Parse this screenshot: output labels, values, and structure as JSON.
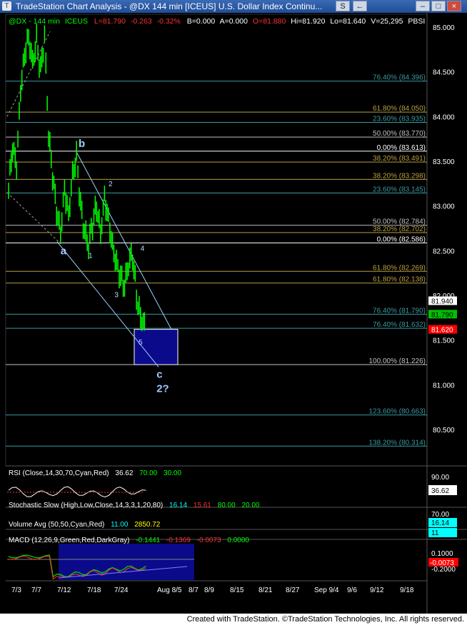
{
  "window": {
    "title": "TradeStation Chart Analysis - @DX 144 min [ICEUS] U.S. Dollar Index Continu...",
    "buttons": [
      "S",
      "←",
      "–",
      "□",
      "×"
    ]
  },
  "header": {
    "symbol": "@DX - 144 min",
    "exchange": "ICEUS",
    "last": "L=81.790",
    "change": "-0.263",
    "change_pct": "-0.32%",
    "bid": "B=0.000",
    "ask": "A=0.000",
    "open": "O=81.880",
    "high": "Hi=81.920",
    "low": "Lo=81.640",
    "volume": "V=25,295",
    "pbsi": "PBSI"
  },
  "price_axis": {
    "ticks": [
      "85.000",
      "84.500",
      "84.000",
      "83.500",
      "83.000",
      "82.500",
      "82.000",
      "81.500",
      "81.000",
      "80.500"
    ],
    "tick_values": [
      85.0,
      84.5,
      84.0,
      83.5,
      83.0,
      82.5,
      82.0,
      81.5,
      81.0,
      80.5
    ],
    "tags": [
      {
        "text": "81.940",
        "value": 81.94,
        "bg": "#ffffff",
        "fg": "#000000"
      },
      {
        "text": "81.790",
        "value": 81.79,
        "bg": "#00c000",
        "fg": "#000000"
      },
      {
        "text": "81.620",
        "value": 81.62,
        "bg": "#ff0000",
        "fg": "#ffffff"
      }
    ]
  },
  "date_axis": [
    "7/3",
    "7/7",
    "7/12",
    "7/18",
    "7/24",
    "Aug 8/5",
    "8/7",
    "8/9",
    "8/15",
    "8/21",
    "8/27",
    "Sep 9/4",
    "9/6",
    "9/12",
    "9/18"
  ],
  "fib_levels": [
    {
      "label": "76.40% (84.396)",
      "value": 84.396,
      "color": "#3a9aa0"
    },
    {
      "label": "61.80% (84.050)",
      "value": 84.05,
      "color": "#b8a040"
    },
    {
      "label": "23.60% (83.935)",
      "value": 83.935,
      "color": "#3a9aa0"
    },
    {
      "label": "50.00% (83.770)",
      "value": 83.77,
      "color": "#c0c0c0"
    },
    {
      "label": "0.00% (83.613)",
      "value": 83.613,
      "color": "#ffffff"
    },
    {
      "label": "38.20% (83.491)",
      "value": 83.491,
      "color": "#b8a040"
    },
    {
      "label": "38.20% (83.298)",
      "value": 83.298,
      "color": "#b8a040"
    },
    {
      "label": "23.60% (83.145)",
      "value": 83.145,
      "color": "#3a9aa0"
    },
    {
      "label": "50.00% (82.784)",
      "value": 82.784,
      "color": "#c0c0c0"
    },
    {
      "label": "38.20% (82.702)",
      "value": 82.702,
      "color": "#b8a040"
    },
    {
      "label": "0.00% (82.586)",
      "value": 82.586,
      "color": "#ffffff"
    },
    {
      "label": "61.80% (82.269)",
      "value": 82.269,
      "color": "#b8a040"
    },
    {
      "label": "61.80% (82.138)",
      "value": 82.138,
      "color": "#b8a040"
    },
    {
      "label": "76.40% (81.790)",
      "value": 81.79,
      "color": "#3a9aa0"
    },
    {
      "label": "76.40% (81.632)",
      "value": 81.632,
      "color": "#3a9aa0"
    },
    {
      "label": "100.00% (81.226)",
      "value": 81.226,
      "color": "#c0c0c0"
    },
    {
      "label": "123.60% (80.663)",
      "value": 80.663,
      "color": "#3a9aa0"
    },
    {
      "label": "138.20% (80.314)",
      "value": 80.314,
      "color": "#3a9aa0"
    }
  ],
  "wave_labels": [
    {
      "text": "b",
      "date_idx": 17.5,
      "value": 83.66,
      "size": "big"
    },
    {
      "text": "2",
      "date_idx": 25,
      "value": 83.22,
      "size": "small"
    },
    {
      "text": "a",
      "date_idx": 13,
      "value": 82.46,
      "size": "big"
    },
    {
      "text": "1",
      "date_idx": 20,
      "value": 82.42,
      "size": "small"
    },
    {
      "text": "4",
      "date_idx": 33,
      "value": 82.5,
      "size": "small"
    },
    {
      "text": "3",
      "date_idx": 26.5,
      "value": 81.98,
      "size": "small"
    },
    {
      "text": "5",
      "date_idx": 32.5,
      "value": 81.45,
      "size": "small"
    },
    {
      "text": "c",
      "date_idx": 37,
      "value": 81.08,
      "size": "big"
    },
    {
      "text": "2?",
      "date_idx": 37,
      "value": 80.92,
      "size": "big"
    }
  ],
  "indicators": {
    "rsi": {
      "label": "RSI (Close,14,30,70,Cyan,Red)",
      "value": "36.62",
      "ob": "70.00",
      "os": "30.00",
      "axis": [
        "90.00"
      ],
      "tag": "36.62"
    },
    "stochastic": {
      "label": "Stochastic Slow (High,Low,Close,14,3,3,1,20,80)",
      "k": "16.14",
      "d": "15.61",
      "ob": "80.00",
      "os": "20.00",
      "axis": [
        "70.00"
      ],
      "tag": "16.14"
    },
    "volume": {
      "label": "Volume Avg (50,50,Cyan,Red)",
      "value": "11.00",
      "avg": "2850.72",
      "tag": "11"
    },
    "macd": {
      "label": "MACD (12,26,9,Green,Red,DarkGray)",
      "macd": "-0.1441",
      "signal": "-0.1369",
      "hist": "-0.0073",
      "zero": "0.0000",
      "axis": [
        "0.1000",
        "-0.2000"
      ],
      "tag": "-0.0073"
    }
  },
  "footer": "Created with TradeStation. ©TradeStation Technologies, Inc. All rights reserved.",
  "chart_data": {
    "type": "candlestick",
    "title": "",
    "symbol": "@DX",
    "interval": "144 min",
    "ylim": [
      80.2,
      85.05
    ],
    "x_ticks": [
      "7/3",
      "7/7",
      "7/12",
      "7/18",
      "7/24",
      "Aug 8/5",
      "8/7",
      "8/9",
      "8/15",
      "8/21",
      "8/27",
      "Sep 9/4",
      "9/6",
      "9/12",
      "9/18"
    ],
    "close_path": [
      [
        0,
        83.2
      ],
      [
        1,
        83.65
      ],
      [
        2,
        83.45
      ],
      [
        3,
        84.3
      ],
      [
        4,
        84.7
      ],
      [
        5,
        84.9
      ],
      [
        6,
        84.6
      ],
      [
        7,
        84.85
      ],
      [
        8,
        84.5
      ],
      [
        9,
        84.9
      ],
      [
        10,
        83.8
      ],
      [
        11,
        83.35
      ],
      [
        12,
        82.95
      ],
      [
        13,
        82.7
      ],
      [
        14,
        83.2
      ],
      [
        15,
        82.9
      ],
      [
        16,
        83.35
      ],
      [
        17,
        83.55
      ],
      [
        18,
        83.0
      ],
      [
        19,
        82.7
      ],
      [
        20,
        82.55
      ],
      [
        21,
        82.8
      ],
      [
        22,
        83.0
      ],
      [
        23,
        82.7
      ],
      [
        24,
        83.1
      ],
      [
        25,
        82.85
      ],
      [
        26,
        82.55
      ],
      [
        27,
        82.35
      ],
      [
        28,
        82.2
      ],
      [
        29,
        82.1
      ],
      [
        30,
        82.35
      ],
      [
        31,
        82.45
      ],
      [
        32,
        82.0
      ],
      [
        33,
        81.75
      ],
      [
        34,
        81.7
      ]
    ],
    "last_price": 81.79
  }
}
